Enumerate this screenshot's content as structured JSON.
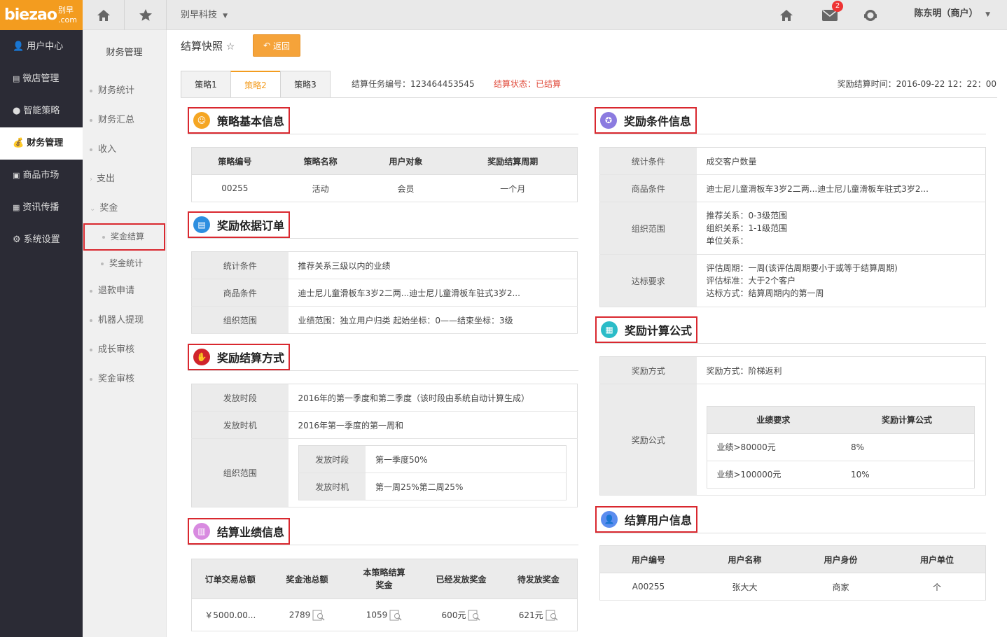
{
  "brand": {
    "logo": "biezao",
    "logo_cn": "别早",
    "logo_domain": ".com",
    "color": "#f39c1f"
  },
  "topbar": {
    "company": "别早科技",
    "user": "陈东明（商户）",
    "mail_badge": "2"
  },
  "sidebar": {
    "items": [
      {
        "label": "用户中心",
        "icon": "user-icon"
      },
      {
        "label": "微店管理",
        "icon": "store-icon"
      },
      {
        "label": "智能策略",
        "icon": "palette-icon"
      },
      {
        "label": "财务管理",
        "icon": "money-bag-icon"
      },
      {
        "label": "商品市场",
        "icon": "box-icon"
      },
      {
        "label": "资讯传播",
        "icon": "grid-icon"
      },
      {
        "label": "系统设置",
        "icon": "gear-icon"
      }
    ]
  },
  "subnav": {
    "title": "财务管理",
    "items": {
      "a": "财务统计",
      "b": "财务汇总",
      "c": "收入",
      "d": "支出",
      "e": "奖金",
      "e1": "奖金结算",
      "e2": "奖金统计",
      "f": "退款申请",
      "g": "机器人提现",
      "h": "成长审核",
      "i": "奖金审核"
    }
  },
  "page": {
    "title": "结算快照",
    "back": "返回"
  },
  "tabs": [
    "策略1",
    "策略2",
    "策略3"
  ],
  "task": {
    "no": "结算任务编号：123464453545",
    "status": "结算状态：已结算",
    "time": "奖励结算时间：2016-09-22 12：22：00"
  },
  "basic": {
    "title": "策略基本信息",
    "headers": [
      "策略编号",
      "策略名称",
      "用户对象",
      "奖励结算周期"
    ],
    "row": [
      "00255",
      "活动",
      "会员",
      "一个月"
    ]
  },
  "orders": {
    "title": "奖励依据订单",
    "rows": [
      {
        "k": "统计条件",
        "v": "推荐关系三级以内的业绩"
      },
      {
        "k": "商品条件",
        "v": "迪士尼儿童滑板车3岁2二两...迪士尼儿童滑板车驻式3岁2..."
      },
      {
        "k": "组织范围",
        "v": "业绩范围：独立用户归类 起始坐标：0——结束坐标：3级"
      }
    ]
  },
  "settle_method": {
    "title": "奖励结算方式",
    "rows": [
      {
        "k": "发放时段",
        "v": "2016年的第一季度和第二季度（该时段由系统自动计算生成）"
      },
      {
        "k": "发放时机",
        "v": "2016年第一季度的第一周和"
      }
    ],
    "org": {
      "k": "组织范围",
      "inner": [
        {
          "k": "发放时段",
          "v": "第一季度50%"
        },
        {
          "k": "发放时机",
          "v": "第一周25%第二周25%"
        }
      ]
    }
  },
  "perf": {
    "title": "结算业绩信息",
    "headers": [
      "订单交易总额",
      "奖金池总额",
      "本策略结算奖金",
      "已经发放奖金",
      "待发放奖金"
    ],
    "row": [
      "￥5000.00...",
      "2789",
      "1059",
      "600元",
      "621元"
    ]
  },
  "conditions": {
    "title": "奖励条件信息",
    "rows": [
      {
        "k": "统计条件",
        "v": [
          "成交客户数量"
        ]
      },
      {
        "k": "商品条件",
        "v": [
          "迪士尼儿童滑板车3岁2二两...迪士尼儿童滑板车驻式3岁2..."
        ]
      },
      {
        "k": "组织范围",
        "v": [
          "推荐关系：0-3级范围",
          "组织关系：1-1级范围",
          "单位关系："
        ]
      },
      {
        "k": "达标要求",
        "v": [
          "评估周期：一周(该评估周期要小于或等于结算周期)",
          "评估标准：大于2个客户",
          "达标方式：结算周期内的第一周"
        ]
      }
    ]
  },
  "formula": {
    "title": "奖励计算公式",
    "mode_k": "奖励方式",
    "mode_v": "奖励方式：阶梯返利",
    "formula_k": "奖励公式",
    "headers": [
      "业绩要求",
      "奖励计算公式"
    ],
    "rows": [
      [
        "业绩>80000元",
        "8%"
      ],
      [
        "业绩>100000元",
        "10%"
      ]
    ]
  },
  "users": {
    "title": "结算用户信息",
    "headers": [
      "用户编号",
      "用户名称",
      "用户身份",
      "用户单位"
    ],
    "row": [
      "A00255",
      "张大大",
      "商家",
      "个"
    ]
  }
}
